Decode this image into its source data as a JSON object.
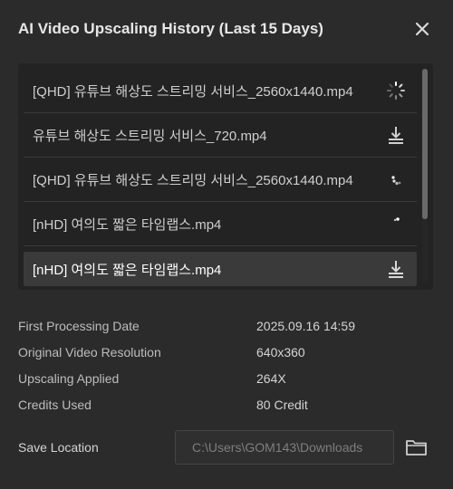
{
  "dialog": {
    "title": "AI Video Upscaling History (Last 15 Days)",
    "close_icon": "close-icon"
  },
  "history": {
    "items": [
      {
        "name": "[QHD] 유튜브 해상도 스트리밍 서비스_2560x1440.mp4",
        "status_icon": "spinner-icon"
      },
      {
        "name": "유튜브 해상도 스트리밍 서비스_720.mp4",
        "status_icon": "download-icon"
      },
      {
        "name": "[QHD] 유튜브 해상도 스트리밍 서비스_2560x1440.mp4",
        "status_icon": "spinner-icon"
      },
      {
        "name": "[nHD] 여의도 짧은 타임랩스.mp4",
        "status_icon": "spinner-icon"
      },
      {
        "name": "[nHD] 여의도 짧은 타임랩스.mp4",
        "status_icon": "download-icon",
        "selected": true
      }
    ]
  },
  "details": {
    "first_processing_date_label": "First Processing Date",
    "first_processing_date_value": "2025.09.16 14:59",
    "original_resolution_label": "Original Video Resolution",
    "original_resolution_value": "640x360",
    "upscaling_label": "Upscaling Applied",
    "upscaling_value": "264X",
    "credits_label": "Credits Used",
    "credits_value": "80 Credit"
  },
  "save": {
    "label": "Save Location",
    "path": "C:\\Users\\GOM143\\Downloads",
    "folder_icon": "folder-icon"
  },
  "colors": {
    "background": "#2b2b2b",
    "panel": "#232323",
    "selected_row": "#3a3a3a",
    "text": "#d9d9d9"
  }
}
